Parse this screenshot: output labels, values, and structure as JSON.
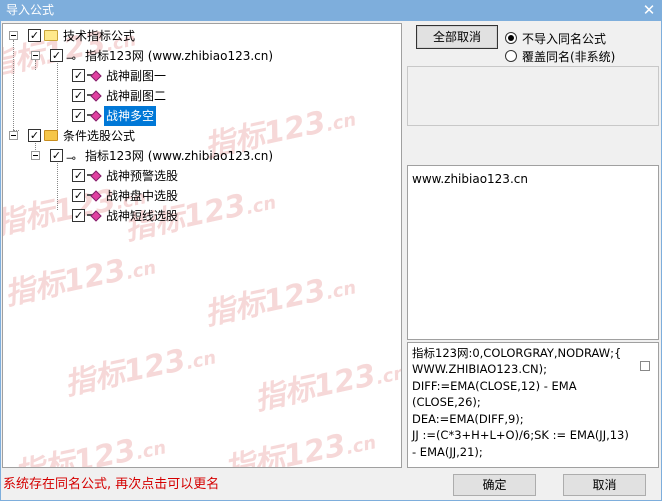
{
  "window": {
    "title": "导入公式",
    "close_glyph": "✕"
  },
  "tree": {
    "group1": {
      "label": "技术指标公式",
      "icon": "folder-icon",
      "checked": true
    },
    "group1_child": {
      "label": "指标123网 (www.zhibiao123.cn)",
      "icon": "key-icon",
      "checked": true
    },
    "group1_items": [
      {
        "label": "战神副图一",
        "checked": true,
        "selected": false
      },
      {
        "label": "战神副图二",
        "checked": true,
        "selected": false
      },
      {
        "label": "战神多空",
        "checked": true,
        "selected": true
      }
    ],
    "group2": {
      "label": "条件选股公式",
      "icon": "folder-open-icon",
      "checked": true
    },
    "group2_child": {
      "label": "指标123网 (www.zhibiao123.cn)",
      "icon": "key-icon",
      "checked": true
    },
    "group2_items": [
      {
        "label": "战神预警选股",
        "checked": true
      },
      {
        "label": "战神盘中选股",
        "checked": true
      },
      {
        "label": "战神短线选股",
        "checked": true
      }
    ],
    "check_glyph": "✓",
    "expander_glyph": "−"
  },
  "watermark": {
    "main": "指标123",
    "suffix": ".cn"
  },
  "options": {
    "deselect_all_label": "全部取消",
    "radio_no_import": "不导入同名公式",
    "radio_overwrite": "覆盖同名(非系统)",
    "selected_radio": "no_import"
  },
  "description": {
    "text": "www.zhibiao123.cn"
  },
  "formula": {
    "lines": [
      "指标123网:0,COLORGRAY,NODRAW;{",
      "WWW.ZHIBIAO123.CN);",
      "DIFF:=EMA(CLOSE,12) - EMA",
      "(CLOSE,26);",
      "DEA:=EMA(DIFF,9);",
      "JJ :=(C*3+H+L+O)/6;SK := EMA(JJ,13)",
      "- EMA(JJ,21);"
    ]
  },
  "status_message": "系统存在同名公式, 再次点击可以更名",
  "buttons": {
    "ok_label": "确定",
    "cancel_label": "取消"
  },
  "colors": {
    "titlebar": "#7eaedc",
    "selection": "#0078d7",
    "status_text": "#d40000",
    "watermark": "#f2c4c4"
  }
}
